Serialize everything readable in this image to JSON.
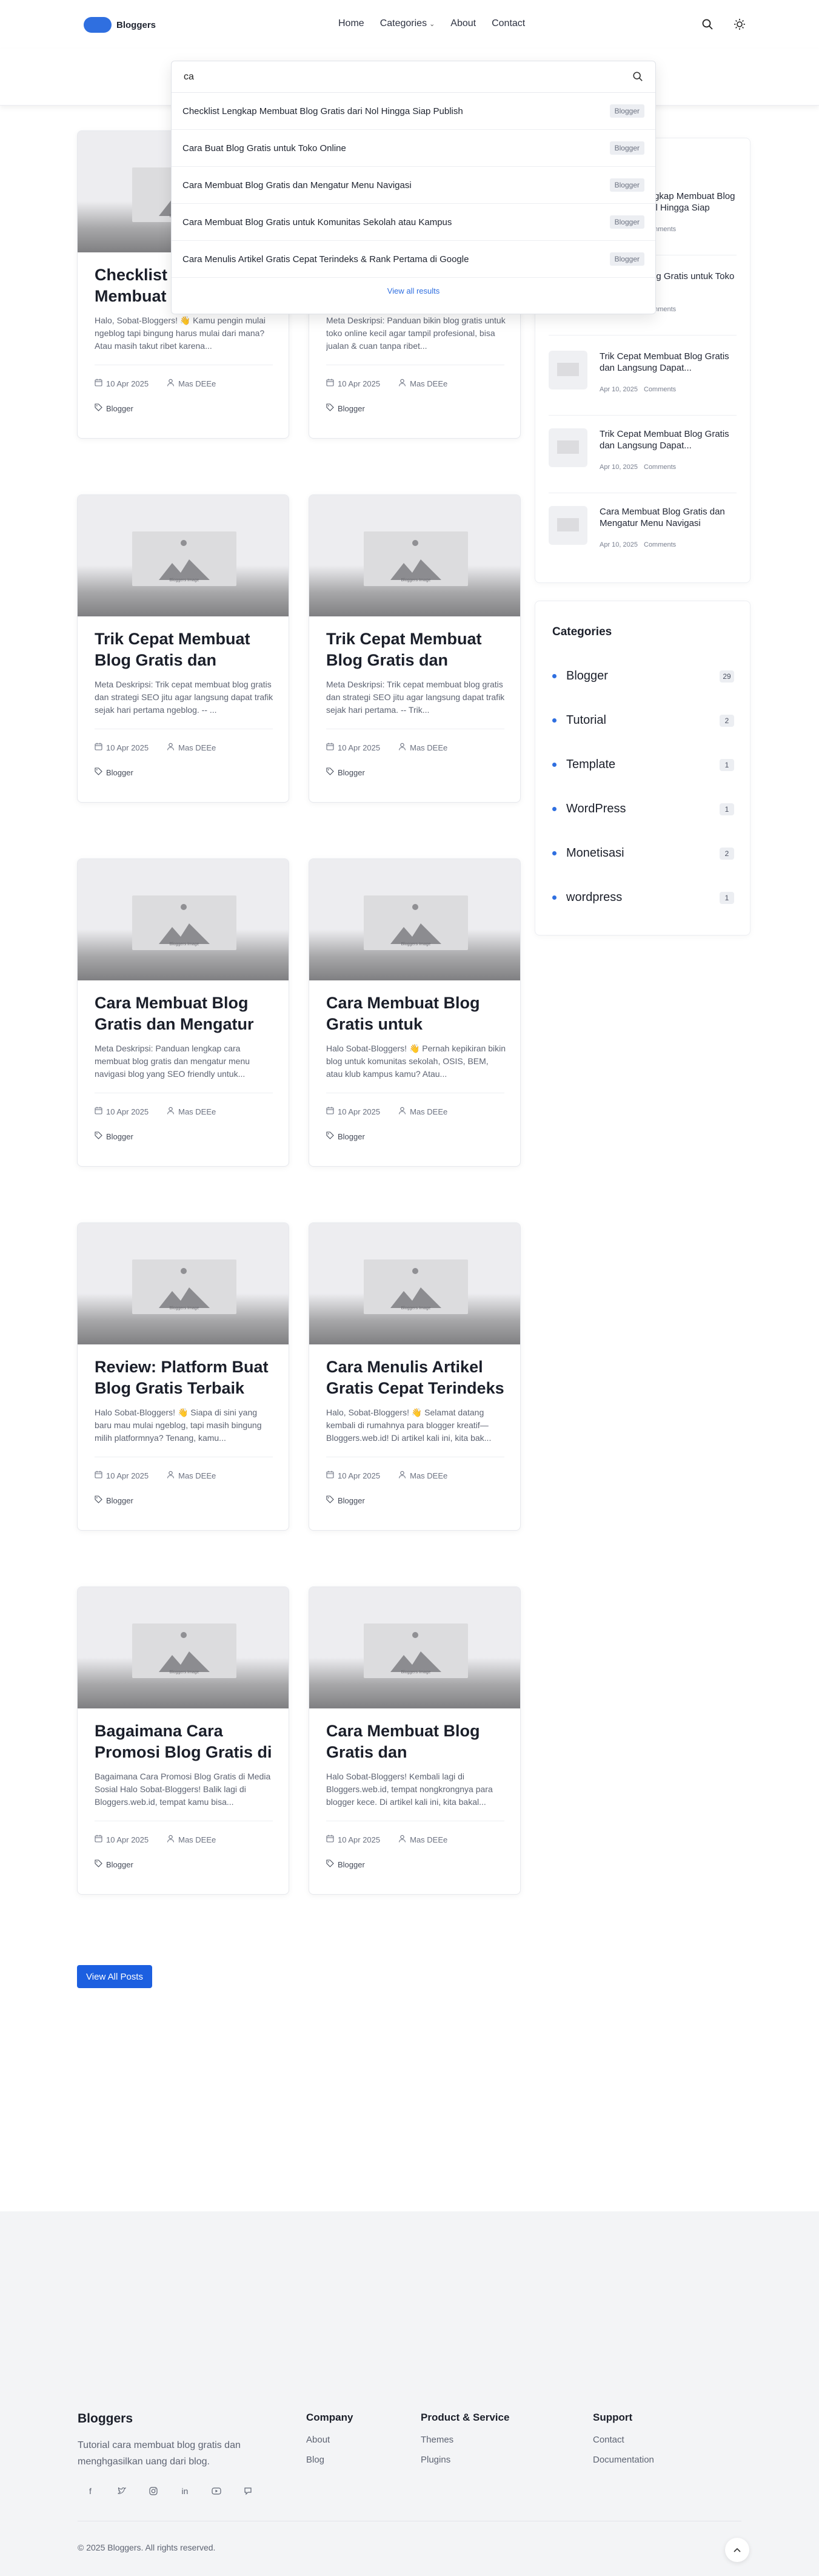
{
  "brand": {
    "name": "Bloggers",
    "color": "#2f6fe0"
  },
  "nav": {
    "items": [
      "Home",
      "Categories",
      "About",
      "Contact"
    ]
  },
  "header_icons": [
    "search-icon",
    "sun-icon"
  ],
  "search": {
    "value": "ca",
    "results": [
      {
        "title": "Checklist Lengkap Membuat Blog Gratis dari Nol Hingga Siap Publish",
        "badge": "Blogger"
      },
      {
        "title": "Cara Buat Blog Gratis untuk Toko Online",
        "badge": "Blogger"
      },
      {
        "title": "Cara Membuat Blog Gratis dan Mengatur Menu Navigasi",
        "badge": "Blogger"
      },
      {
        "title": "Cara Membuat Blog Gratis untuk Komunitas Sekolah atau Kampus",
        "badge": "Blogger"
      },
      {
        "title": "Cara Menulis Artikel Gratis Cepat Terindeks & Rank Pertama di Google",
        "badge": "Blogger"
      }
    ],
    "view_all": "View all results"
  },
  "thumb_caption": "Bloggers Image",
  "posts": [
    {
      "title": "Checklist Lengkap Membuat Blog Gratis dari Nol Hingga Siap Publish",
      "excerpt": "Halo, Sobat-Bloggers! 👋 Kamu pengin mulai ngeblog tapi bingung harus mulai dari mana? Atau masih takut ribet karena...",
      "date": "10 Apr 2025",
      "author": "Mas DEEe",
      "tag": "Blogger"
    },
    {
      "title": "Cara Buat Blog Gratis untuk Toko Online",
      "excerpt": "Meta Deskripsi: Panduan bikin blog gratis untuk toko online kecil agar tampil profesional, bisa jualan & cuan tanpa ribet...",
      "date": "10 Apr 2025",
      "author": "Mas DEEe",
      "tag": "Blogger"
    },
    {
      "title": "Trik Cepat Membuat Blog Gratis dan Langsung Dapat Trafik",
      "excerpt": "Meta Deskripsi: Trik cepat membuat blog gratis dan strategi SEO jitu agar langsung dapat trafik sejak hari pertama ngeblog. -- ...",
      "date": "10 Apr 2025",
      "author": "Mas DEEe",
      "tag": "Blogger"
    },
    {
      "title": "Trik Cepat Membuat Blog Gratis dan Langsung Dapat Trafik",
      "excerpt": "Meta Deskripsi: Trik cepat membuat blog gratis dan strategi SEO jitu agar langsung dapat trafik sejak hari pertama. -- Trik...",
      "date": "10 Apr 2025",
      "author": "Mas DEEe",
      "tag": "Blogger"
    },
    {
      "title": "Cara Membuat Blog Gratis dan Mengatur Menu Navigasi",
      "excerpt": "Meta Deskripsi: Panduan lengkap cara membuat blog gratis dan mengatur menu navigasi blog yang SEO friendly untuk...",
      "date": "10 Apr 2025",
      "author": "Mas DEEe",
      "tag": "Blogger"
    },
    {
      "title": "Cara Membuat Blog Gratis untuk Komunitas Sekolah atau Kampus",
      "excerpt": "Halo Sobat-Bloggers! 👋 Pernah kepikiran bikin blog untuk komunitas sekolah, OSIS, BEM, atau klub kampus kamu? Atau...",
      "date": "10 Apr 2025",
      "author": "Mas DEEe",
      "tag": "Blogger"
    },
    {
      "title": "Review: Platform Buat Blog Gratis Terbaik untuk Pemula",
      "excerpt": "Halo Sobat-Bloggers! 👋 Siapa di sini yang baru mau mulai ngeblog, tapi masih bingung milih platformnya? Tenang, kamu...",
      "date": "10 Apr 2025",
      "author": "Mas DEEe",
      "tag": "Blogger"
    },
    {
      "title": "Cara Menulis Artikel Gratis Cepat Terindeks & Rank Pertama di Google",
      "excerpt": "Halo, Sobat-Bloggers! 👋 Selamat datang kembali di rumahnya para blogger kreatif—Bloggers.web.id! Di artikel kali ini, kita bak...",
      "date": "10 Apr 2025",
      "author": "Mas DEEe",
      "tag": "Blogger"
    },
    {
      "title": "Bagaimana Cara Promosi Blog Gratis di Media Sosial",
      "excerpt": "Bagaimana Cara Promosi Blog Gratis di Media Sosial Halo Sobat-Bloggers! Balik lagi di Bloggers.web.id, tempat kamu bisa...",
      "date": "10 Apr 2025",
      "author": "Mas DEEe",
      "tag": "Blogger"
    },
    {
      "title": "Cara Membuat Blog Gratis dan Memaksimalkan Hasilnya",
      "excerpt": "Halo Sobat-Bloggers! Kembali lagi di Bloggers.web.id, tempat nongkrongnya para blogger kece. Di artikel kali ini, kita bakal...",
      "date": "10 Apr 2025",
      "author": "Mas DEEe",
      "tag": "Blogger"
    }
  ],
  "view_all_posts": "View All Posts",
  "recent_posts": [
    {
      "title": "Checklist Lengkap Membuat Blog Gratis dari Nol Hingga Siap Publish",
      "date": "Apr 10, 2025",
      "comments": "Comments"
    },
    {
      "title": "Cara Buat Blog Gratis untuk Toko Online",
      "date": "Apr 10, 2025",
      "comments": "Comments"
    },
    {
      "title": "Trik Cepat Membuat Blog Gratis dan Langsung Dapat...",
      "date": "Apr 10, 2025",
      "comments": "Comments"
    },
    {
      "title": "Trik Cepat Membuat Blog Gratis dan Langsung Dapat...",
      "date": "Apr 10, 2025",
      "comments": "Comments"
    },
    {
      "title": "Cara Membuat Blog Gratis dan Mengatur Menu Navigasi",
      "date": "Apr 10, 2025",
      "comments": "Comments"
    }
  ],
  "categories": {
    "title": "Categories",
    "items": [
      {
        "name": "Blogger",
        "count": "29"
      },
      {
        "name": "Tutorial",
        "count": "2"
      },
      {
        "name": "Template",
        "count": "1"
      },
      {
        "name": "WordPress",
        "count": "1"
      },
      {
        "name": "Monetisasi",
        "count": "2"
      },
      {
        "name": "wordpress",
        "count": "1"
      }
    ]
  },
  "footer": {
    "brand": "Bloggers",
    "description": "Tutorial cara membuat blog gratis dan menghgasilkan uang dari blog.",
    "social": [
      "facebook-icon",
      "twitter-icon",
      "instagram-icon",
      "linkedin-icon",
      "youtube-icon",
      "discord-icon"
    ],
    "columns": [
      {
        "title": "Company",
        "links": [
          "About",
          "Blog"
        ]
      },
      {
        "title": "Product & Service",
        "links": [
          "Themes",
          "Plugins"
        ]
      },
      {
        "title": "Support",
        "links": [
          "Contact",
          "Documentation"
        ]
      }
    ],
    "copyright": "© 2025 Bloggers. All rights reserved."
  }
}
